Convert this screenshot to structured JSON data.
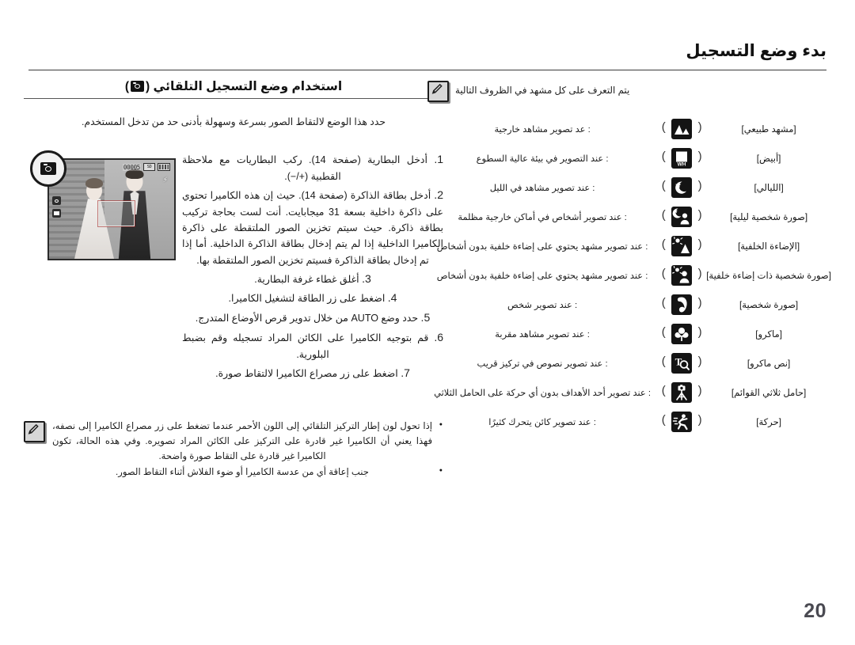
{
  "header": {
    "title": "بدء وضع التسجيل"
  },
  "page": {
    "number": "20"
  },
  "left_column": {
    "section_title_before": "استخدام وضع التسجيل التلقائي (",
    "section_title_after": ")",
    "section_icon": "camera-icon",
    "intro": "حدد هذا الوضع لالتقاط الصور بسرعة وسهولة بأدنى حد من تدخل المستخدم.",
    "steps": [
      {
        "number": "1.",
        "text": "أدخل البطارية (صفحة 14). ركب البطاريات مع ملاحظة القطبية (+/−)."
      },
      {
        "number": "2.",
        "text": "أدخل بطاقة الذاكرة (صفحة 14). حيث إن هذه الكاميرا تحتوي على ذاكرة داخلية بسعة 31 ميجابايت. أنت لست بحاجة تركيب بطاقة ذاكرة. حيث سيتم تخزين الصور الملتقطة على ذاكرة الكاميرا الداخلية إذا لم يتم إدخال بطاقة الذاكرة الداخلية. أما إذا تم إدخال بطاقة الذاكرة فسيتم تخزين الصور الملتقطة بها."
      },
      {
        "number": "3.",
        "text": "أغلق غطاء غرفة البطارية."
      },
      {
        "number": "4.",
        "text": "اضغط على زر الطاقة لتشغيل الكاميرا."
      },
      {
        "number": "5.",
        "text": "حدد وضع AUTO من خلال تدوير قرص الأوضاع المتدرج."
      },
      {
        "number": "6.",
        "text": "قم بتوجيه الكاميرا على الكائن المراد تسجيله وقم بضبط البلورية."
      },
      {
        "number": "7.",
        "text": "اضغط على زر مصراع الكاميرا لالتقاط صورة."
      }
    ],
    "lcd": {
      "badge_icon": "camera-mode-badge-icon",
      "counter": "00005",
      "card_chip_label": "SD",
      "battery_icon": "battery-icon",
      "flash_icon": "flash-icon",
      "af_frame": "af-frame",
      "left_icons": [
        "camera-icon",
        "film-icon"
      ]
    },
    "notes": {
      "icon": "note-pencil-icon",
      "items": [
        "إذا تحول لون إطار التركيز التلقائي إلى اللون الأحمر عندما تضغط على زر مصراع الكاميرا إلى نصفه، فهذا يعني أن الكاميرا غير قادرة على التركيز على الكائن المراد تصويره. وفي هذه الحالة، تكون الكاميرا غير قادرة على التقاط صورة واضحة.",
        "جنب إعاقة أي من عدسة الكاميرا أو ضوء الفلاش أثناء التقاط الصور."
      ]
    }
  },
  "right_column": {
    "note": {
      "icon": "note-pencil-icon",
      "text": "يتم التعرف على كل مشهد في الظروف التالية"
    },
    "scenes": [
      {
        "label": "[مشهد طبيعي]",
        "icon": "landscape-icon",
        "description": ": عد تصوير مشاهد خارجية"
      },
      {
        "label": "[أبيض]",
        "icon": "white-icon",
        "description": ": عند التصوير في بيئة عالية السطوع"
      },
      {
        "label": "[الليالي]",
        "icon": "night-icon",
        "description": ": عند تصوير مشاهد في الليل"
      },
      {
        "label": "[صورة شخصية ليلية]",
        "icon": "night-portrait-icon",
        "description": ": عند تصوير أشخاص في أماكن خارجية مظلمة"
      },
      {
        "label": "[الإضاءة الخلفية]",
        "icon": "backlight-icon",
        "description": ": عند تصوير مشهد يحتوي على إضاءة خلفية بدون أشخاص"
      },
      {
        "label": "[صورة شخصية ذات إضاءة خلفية]",
        "icon": "backlight-portrait-icon",
        "description": ": عند تصوير مشهد يحتوي على إضاءة خلفية بدون أشخاص"
      },
      {
        "label": "[صورة شخصية]",
        "icon": "portrait-icon",
        "description": ": عند تصوير شخص"
      },
      {
        "label": "[ماكرو]",
        "icon": "macro-icon",
        "description": ": عند تصوير مشاهد مقربة"
      },
      {
        "label": "[نص ماكرو]",
        "icon": "text-macro-icon",
        "description": ": عند تصوير نصوص في تركيز قريب"
      },
      {
        "label": "[حامل ثلاثي القوائم]",
        "icon": "tripod-icon",
        "description": ": عند تصوير أحد الأهداف بدون أي حركة على الحامل الثلاثي"
      },
      {
        "label": "[حركة]",
        "icon": "action-icon",
        "description": ": عند تصوير كائن يتحرك كثيرًا"
      }
    ]
  },
  "colors": {
    "ink": "#1a1a1a",
    "tile_bg": "#141414",
    "page_number": "#4a4a52"
  }
}
